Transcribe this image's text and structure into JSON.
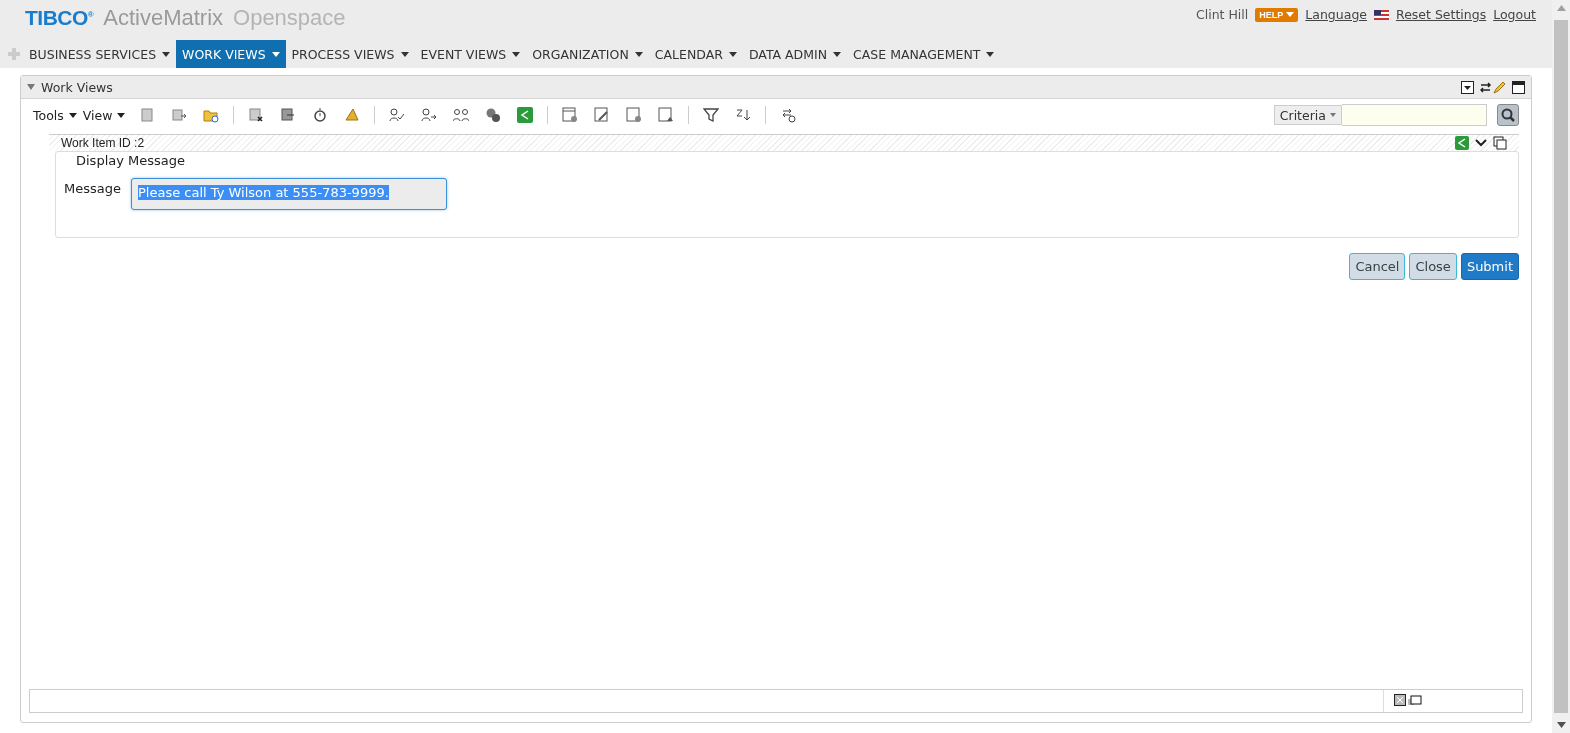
{
  "header": {
    "brand": "TIBCO",
    "registered": "®",
    "product": "ActiveMatrix",
    "suite": "Openspace",
    "user": "Clint Hill",
    "help": "HELP",
    "links": [
      "Language",
      "Reset Settings",
      "Logout"
    ]
  },
  "menu": [
    {
      "label": "BUSINESS SERVICES",
      "selected": false
    },
    {
      "label": "WORK VIEWS",
      "selected": true
    },
    {
      "label": "PROCESS VIEWS",
      "selected": false
    },
    {
      "label": "EVENT VIEWS",
      "selected": false
    },
    {
      "label": "ORGANIZATION",
      "selected": false
    },
    {
      "label": "CALENDAR",
      "selected": false
    },
    {
      "label": "DATA ADMIN",
      "selected": false
    },
    {
      "label": "CASE MANAGEMENT",
      "selected": false
    }
  ],
  "panel": {
    "title": "Work Views",
    "toolbar_menus": [
      "Tools",
      "View"
    ],
    "criteria": "Criteria"
  },
  "work_item": {
    "title": "Work Item ID :2",
    "form_title": "Display Message",
    "field_label": "Message",
    "field_value": "Please call Ty Wilson at 555-783-9999.",
    "value_selected": true,
    "buttons": [
      {
        "label": "Cancel",
        "kind": "secondary"
      },
      {
        "label": "Close",
        "kind": "secondary"
      },
      {
        "label": "Submit",
        "kind": "primary"
      }
    ]
  }
}
